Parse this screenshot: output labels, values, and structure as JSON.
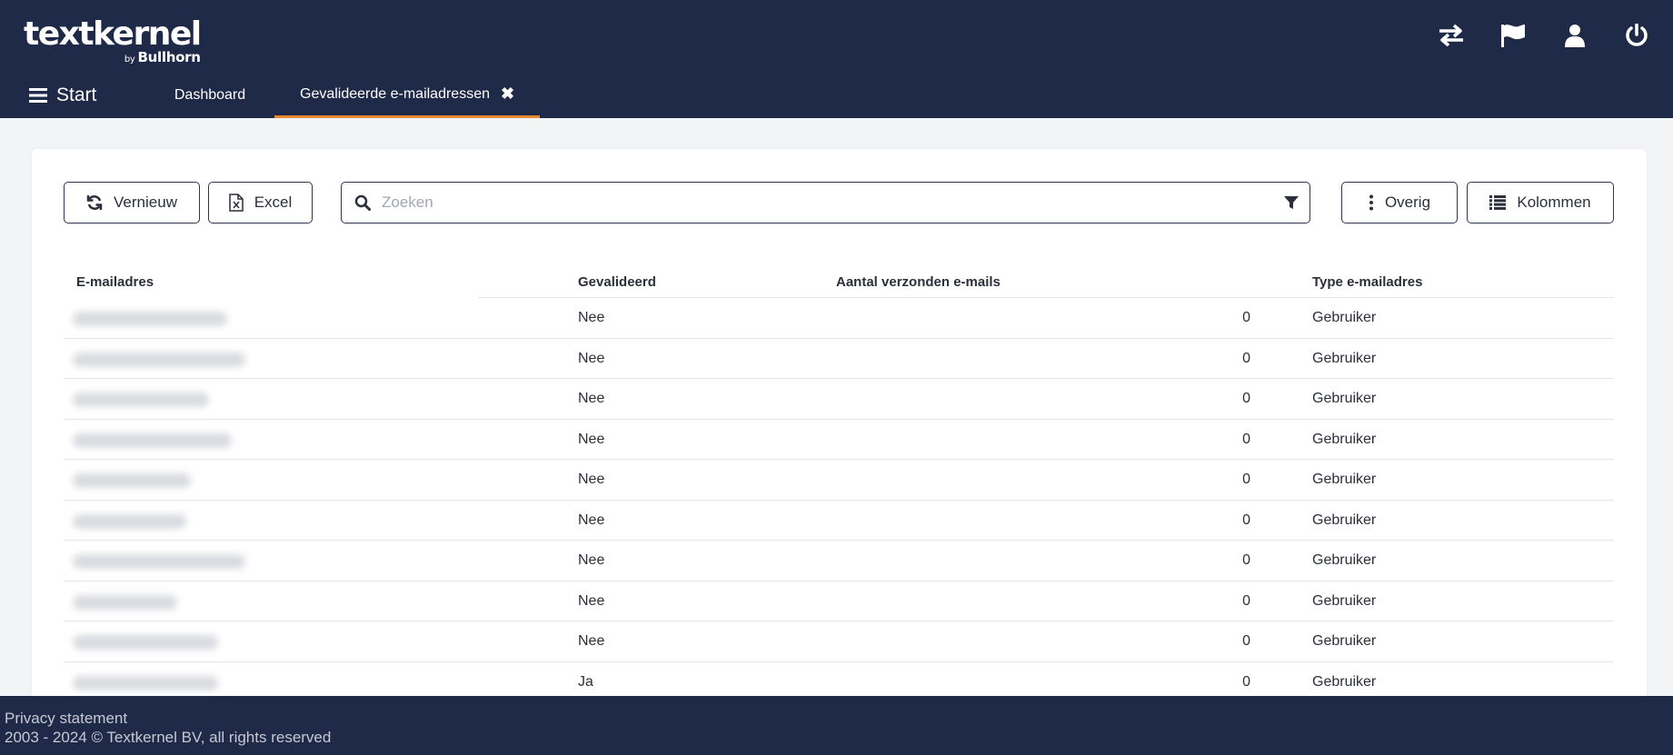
{
  "header": {
    "logo_main": "textkernel",
    "logo_by": "by",
    "logo_sub": "Bullhorn",
    "icons": [
      "swap-icon",
      "flag-icon",
      "user-icon",
      "power-icon"
    ]
  },
  "nav": {
    "start_label": "Start",
    "tabs": [
      {
        "label": "Dashboard",
        "active": false
      },
      {
        "label": "Gevalideerde e-mailadressen",
        "active": true,
        "close": "✖"
      }
    ]
  },
  "toolbar": {
    "refresh_label": "Vernieuw",
    "excel_label": "Excel",
    "search_placeholder": "Zoeken",
    "more_label": "Overig",
    "columns_label": "Kolommen"
  },
  "table": {
    "columns": [
      "E-mailadres",
      "Gevalideerd",
      "Aantal verzonden e-mails",
      "Type e-mailadres"
    ],
    "rows": [
      {
        "validated": "Nee",
        "sent": "0",
        "type": "Gebruiker"
      },
      {
        "validated": "Nee",
        "sent": "0",
        "type": "Gebruiker"
      },
      {
        "validated": "Nee",
        "sent": "0",
        "type": "Gebruiker"
      },
      {
        "validated": "Nee",
        "sent": "0",
        "type": "Gebruiker"
      },
      {
        "validated": "Nee",
        "sent": "0",
        "type": "Gebruiker"
      },
      {
        "validated": "Nee",
        "sent": "0",
        "type": "Gebruiker"
      },
      {
        "validated": "Nee",
        "sent": "0",
        "type": "Gebruiker"
      },
      {
        "validated": "Nee",
        "sent": "0",
        "type": "Gebruiker"
      },
      {
        "validated": "Nee",
        "sent": "0",
        "type": "Gebruiker"
      },
      {
        "validated": "Ja",
        "sent": "0",
        "type": "Gebruiker"
      }
    ]
  },
  "footer": {
    "privacy": "Privacy statement",
    "copyright": "2003 - 2024 © Textkernel BV, all rights reserved"
  },
  "colors": {
    "navy": "#1f2a48",
    "accent": "#e78a2f"
  }
}
